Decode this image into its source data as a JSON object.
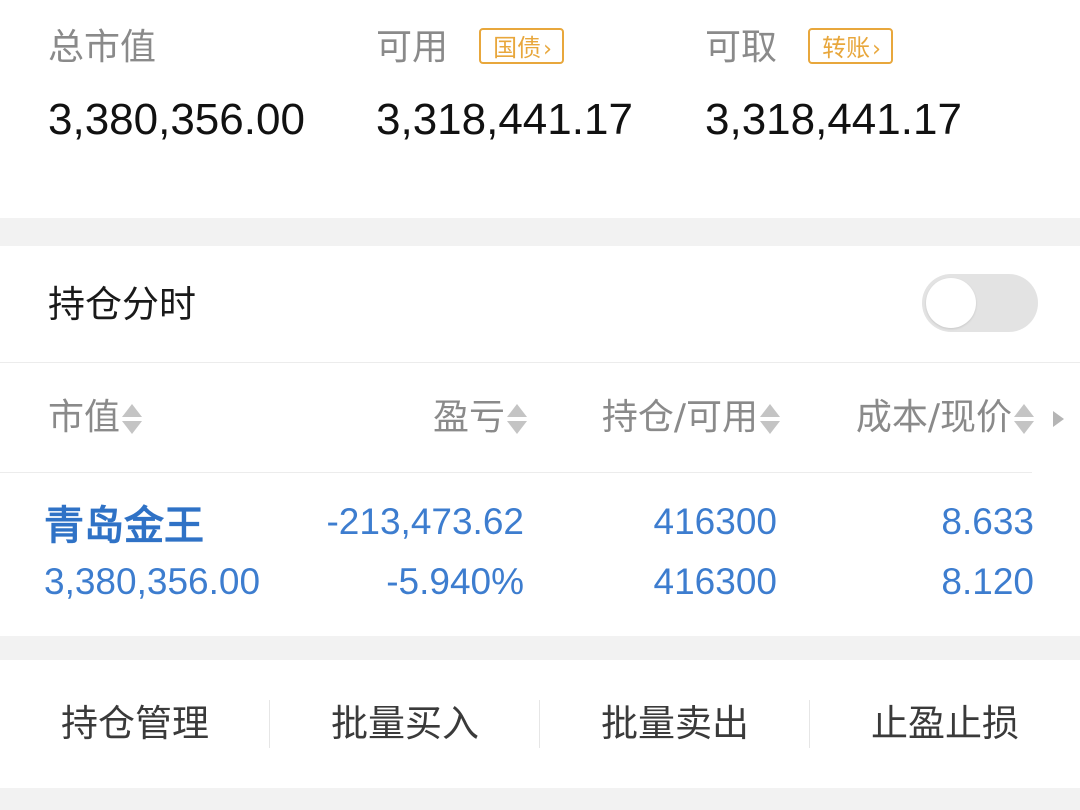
{
  "summary": {
    "total_market_value": {
      "label": "总市值",
      "value": "3,380,356.00"
    },
    "available": {
      "label": "可用",
      "tag": "国债",
      "value": "3,318,441.17"
    },
    "withdrawable": {
      "label": "可取",
      "tag": "转账",
      "value": "3,318,441.17"
    },
    "tag_chevron": "›"
  },
  "positions": {
    "toggle_label": "持仓分时",
    "toggle_on": false,
    "columns": [
      {
        "label": "市值"
      },
      {
        "label": "盈亏"
      },
      {
        "label": "持仓/可用"
      },
      {
        "label": "成本/现价"
      }
    ],
    "rows": [
      {
        "name": "青岛金王",
        "market_value": "3,380,356.00",
        "profit_loss": "-213,473.62",
        "profit_loss_pct": "-5.940%",
        "holding": "416300",
        "available": "416300",
        "cost": "8.633",
        "price": "8.120"
      }
    ]
  },
  "actions": [
    {
      "label": "持仓管理"
    },
    {
      "label": "批量买入"
    },
    {
      "label": "批量卖出"
    },
    {
      "label": "止盈止损"
    }
  ],
  "colors": {
    "accent_blue": "#3d7dcf",
    "tag_orange": "#e8a73c",
    "label_gray": "#8a8a8a"
  }
}
